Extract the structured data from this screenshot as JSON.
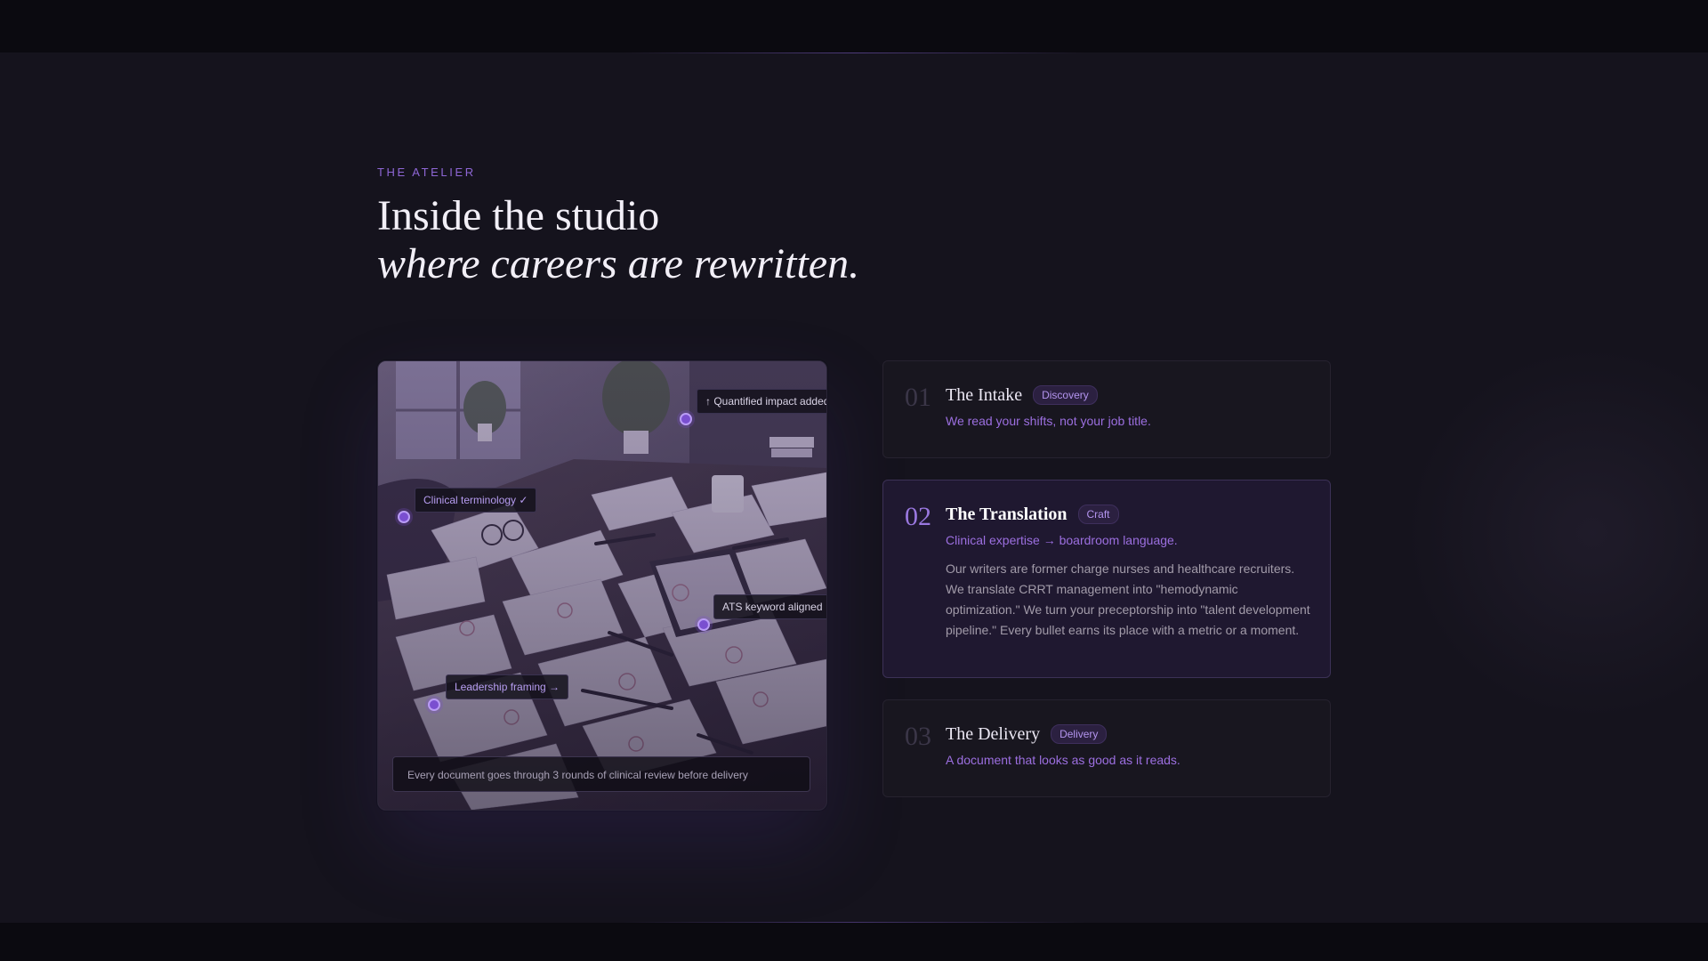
{
  "section": {
    "eyebrow": "THE ATELIER",
    "headline_line1": "Inside the studio",
    "headline_line2": "where careers are rewritten."
  },
  "image_card": {
    "tags": {
      "quantified": "↑ Quantified impact added",
      "clinical": "Clinical terminology ✓",
      "ats": "ATS keyword aligned",
      "leadership": "Leadership framing →"
    },
    "caption": "Every document goes through 3 rounds of clinical review before delivery"
  },
  "steps": [
    {
      "number": "01",
      "title": "The Intake",
      "badge": "Discovery",
      "subtitle": "We read your shifts, not your job title.",
      "active": false
    },
    {
      "number": "02",
      "title": "The Translation",
      "badge": "Craft",
      "subtitle": "Clinical expertise → boardroom language.",
      "body": "Our writers are former charge nurses and healthcare recruiters. We translate CRRT management into \"hemodynamic optimization.\" We turn your preceptorship into \"talent development pipeline.\" Every bullet earns its place with a metric or a moment.",
      "active": true
    },
    {
      "number": "03",
      "title": "The Delivery",
      "badge": "Delivery",
      "subtitle": "A document that looks as good as it reads.",
      "active": false
    }
  ],
  "colors": {
    "accent": "#9c6fe0",
    "background": "#15131d",
    "card": "#18161f",
    "card_active": "#1f1830"
  }
}
